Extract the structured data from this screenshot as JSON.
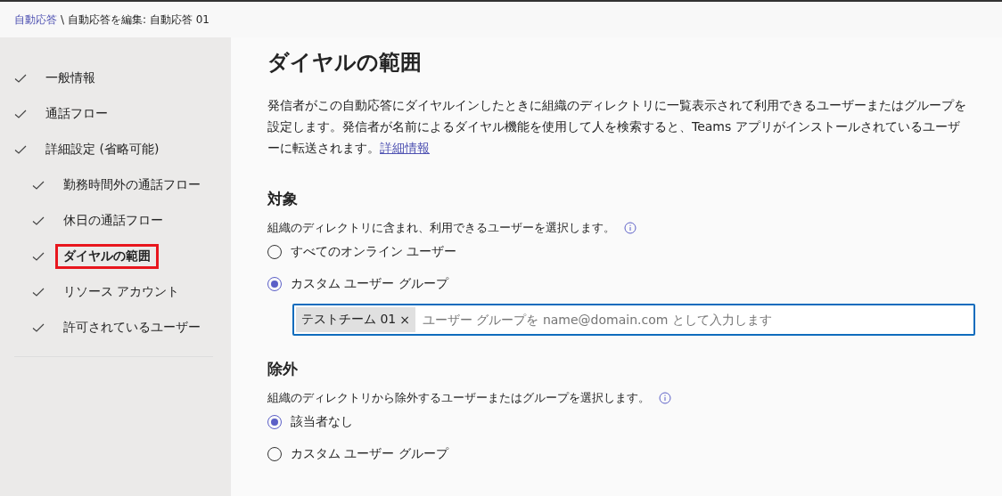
{
  "breadcrumb": {
    "link": "自動応答",
    "separator": "\\",
    "current": "自動応答を編集: 自動応答 01"
  },
  "sidebar": {
    "items": [
      {
        "label": "一般情報",
        "checked": true,
        "selected": false
      },
      {
        "label": "通話フロー",
        "checked": true,
        "selected": false
      },
      {
        "label": "詳細設定 (省略可能)",
        "checked": true,
        "selected": false,
        "children": [
          {
            "label": "勤務時間外の通話フロー",
            "checked": true,
            "selected": false
          },
          {
            "label": "休日の通話フロー",
            "checked": true,
            "selected": false
          },
          {
            "label": "ダイヤルの範囲",
            "checked": true,
            "selected": true
          },
          {
            "label": "リソース アカウント",
            "checked": true,
            "selected": false
          },
          {
            "label": "許可されているユーザー",
            "checked": true,
            "selected": false
          }
        ]
      }
    ]
  },
  "page_title": "ダイヤルの範囲",
  "description": {
    "text": "発信者がこの自動応答にダイヤルインしたときに組織のディレクトリに一覧表示されて利用できるユーザーまたはグループを設定します。発信者が名前によるダイヤル機能を使用して人を検索すると、Teams アプリがインストールされているユーザーに転送されます。",
    "link": "詳細情報"
  },
  "sections": [
    {
      "title": "対象",
      "hint": "組織のディレクトリに含まれ、利用できるユーザーを選択します。",
      "options": [
        {
          "label": "すべてのオンライン ユーザー",
          "selected": false
        },
        {
          "label": "カスタム ユーザー グループ",
          "selected": true
        }
      ],
      "field": {
        "tags": [
          "テストチーム 01"
        ],
        "remove": "×",
        "placeholder": "ユーザー グループを name@domain.com として入力します"
      }
    },
    {
      "title": "除外",
      "hint": "組織のディレクトリから除外するユーザーまたはグループを選択します。",
      "options": [
        {
          "label": "該当者なし",
          "selected": true
        },
        {
          "label": "カスタム ユーザー グループ",
          "selected": false
        }
      ]
    }
  ]
}
